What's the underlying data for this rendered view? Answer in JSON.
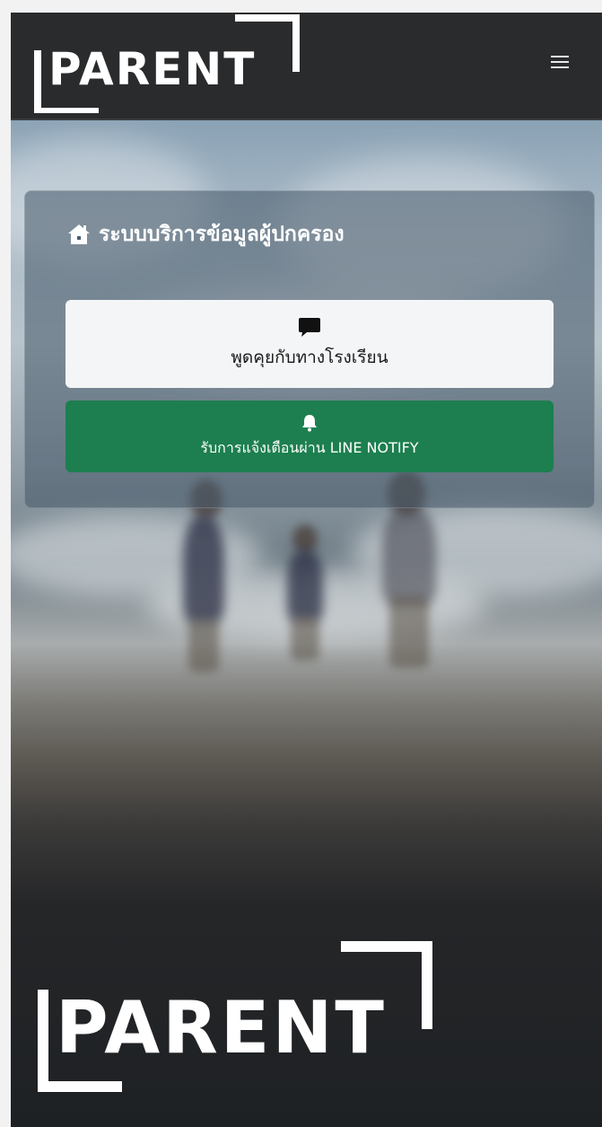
{
  "navbar": {
    "brand_text": "PARENT",
    "menu_icon": "hamburger-menu-icon"
  },
  "card": {
    "icon": "house-icon",
    "title": "ระบบบริการข้อมูลผู้ปกครอง"
  },
  "buttons": {
    "chat": {
      "icon": "chat-bubble-icon",
      "label": "พูดคุยกับทางโรงเรียน"
    },
    "line_notify": {
      "icon": "bell-icon",
      "label": "รับการแจ้งเตือนผ่าน LINE NOTIFY"
    }
  },
  "footer": {
    "brand_text": "PARENT"
  },
  "colors": {
    "navbar_bg": "#2a2b2d",
    "line_button": "#1d7f4f",
    "chat_button": "#f4f5f7"
  }
}
